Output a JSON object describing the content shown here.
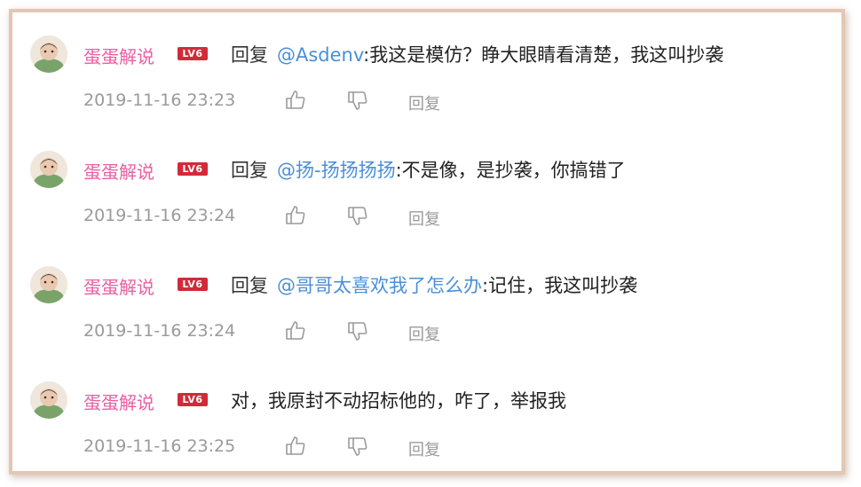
{
  "comments": [
    {
      "username": "蛋蛋解说",
      "level": "LV6",
      "reply_word": "回复",
      "mention": "@Asdenv",
      "text": ":我这是模仿？睁大眼睛看清楚，我这叫抄袭",
      "timestamp": "2019-11-16 23:23",
      "reply_label": "回复"
    },
    {
      "username": "蛋蛋解说",
      "level": "LV6",
      "reply_word": "回复",
      "mention": "@扬-扬扬扬扬",
      "text": ":不是像，是抄袭，你搞错了",
      "timestamp": "2019-11-16 23:24",
      "reply_label": "回复"
    },
    {
      "username": "蛋蛋解说",
      "level": "LV6",
      "reply_word": "回复",
      "mention": "@哥哥太喜欢我了怎么办",
      "text": ":记住，我这叫抄袭",
      "timestamp": "2019-11-16 23:24",
      "reply_label": "回复"
    },
    {
      "username": "蛋蛋解说",
      "level": "LV6",
      "reply_word": "",
      "mention": "",
      "text": "对，我原封不动招标他的，咋了，举报我",
      "timestamp": "2019-11-16 23:25",
      "reply_label": "回复"
    }
  ],
  "icons": {
    "avatar": "avatar-photo",
    "like": "thumbs-up-icon",
    "dislike": "thumbs-down-icon"
  },
  "colors": {
    "username": "#eb5ea3",
    "level_badge": "#d12b39",
    "mention": "#4a8fd9",
    "meta_text": "#9a9a9a",
    "frame_border": "#e3c6b4"
  }
}
